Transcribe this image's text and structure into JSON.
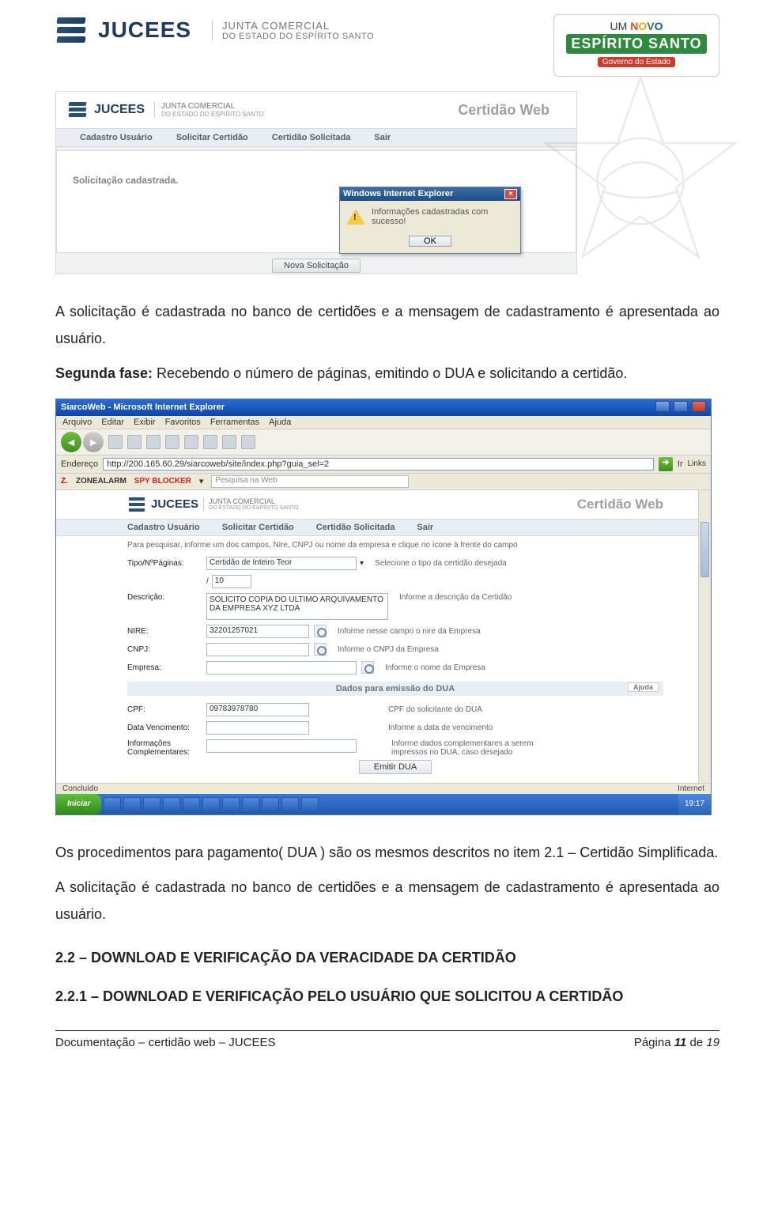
{
  "header": {
    "brand": "JUCEES",
    "sub1": "JUNTA COMERCIAL",
    "sub2": "DO ESTADO DO ESPÍRITO SANTO",
    "novo_prefix": "UM",
    "novo": "NOVO",
    "espirito": "ESPÍRITO SANTO",
    "governo": "Governo do Estado"
  },
  "shot1": {
    "appTitle": "Certidão Web",
    "menu": [
      "Cadastro Usuário",
      "Solicitar Certidão",
      "Certidão Solicitada",
      "Sair"
    ],
    "message": "Solicitação cadastrada.",
    "novaBtn": "Nova Solicitação",
    "dialog": {
      "title": "Windows Internet Explorer",
      "text": "Informações cadastradas com sucesso!",
      "ok": "OK"
    }
  },
  "body": {
    "p1": "A solicitação é cadastrada no banco de certidões e a mensagem de cadastramento é apresentada ao usuário.",
    "p2_lead": "Segunda fase:",
    "p2_rest": " Recebendo o número de páginas, emitindo o DUA e solicitando a certidão.",
    "p3": "Os procedimentos para pagamento( DUA ) são os mesmos descritos no item 2.1 – Certidão Simplificada.",
    "p4": "A solicitação é cadastrada no banco de certidões e a mensagem de cadastramento é apresentada ao usuário.",
    "h1": "2.2 – DOWNLOAD E VERIFICAÇÃO DA VERACIDADE DA CERTIDÃO",
    "h2": "2.2.1 – DOWNLOAD E VERIFICAÇÃO PELO USUÁRIO QUE SOLICITOU A CERTIDÃO"
  },
  "shot2": {
    "windowTitle": "SiarcoWeb - Microsoft Internet Explorer",
    "menus": [
      "Arquivo",
      "Editar",
      "Exibir",
      "Favoritos",
      "Ferramentas",
      "Ajuda"
    ],
    "addrLabel": "Endereço",
    "url": "http://200.165.60.29/siarcoweb/site/index.php?guia_sel=2",
    "go": "Ir",
    "links": "Links",
    "zone_z": "ZONEALARM",
    "zone_spy": "SPY BLOCKER",
    "zone_search": "Pesquisa na Web",
    "cw_title": "Certidão Web",
    "cw_menu": [
      "Cadastro Usuário",
      "Solicitar Certidão",
      "Certidão Solicitada",
      "Sair"
    ],
    "cw_note": "Para pesquisar, informe um dos campos, Nire, CNPJ ou nome da empresa e clique no ícone à frente do campo",
    "form": {
      "tipo_label": "Tipo/NºPáginas:",
      "tipo_value": "Certidão de Inteiro Teor",
      "pagina_value": "10",
      "tipo_hint": "Selecione o tipo da certidão desejada",
      "desc_label": "Descrição:",
      "desc_value": "SOLICITO COPIA DO ULTIMO ARQUIVAMENTO DA EMPRESA XYZ LTDA",
      "desc_hint": "Informe a descrição da Certidão",
      "nire_label": "NIRE:",
      "nire_value": "32201257021",
      "nire_hint": "Informe nesse campo o nire da Empresa",
      "cnpj_label": "CNPJ:",
      "cnpj_value": "",
      "cnpj_hint": "Informe o CNPJ da Empresa",
      "emp_label": "Empresa:",
      "emp_value": "",
      "emp_hint": "Informe o nome da Empresa",
      "dua_section": "Dados para emissão do DUA",
      "dua_help": "Ajuda",
      "cpf_label": "CPF:",
      "cpf_value": "09783978780",
      "cpf_hint": "CPF do solicitante do DUA",
      "data_label": "Data Vencimento:",
      "data_value": "",
      "data_hint": "Informe a data de vencimento",
      "info_label": "Informações Complementares:",
      "info_value": "",
      "info_hint": "Informe dados complementares a serem impressos no DUA, caso desejado",
      "emit": "Emitir DUA"
    },
    "status_left": "Concluído",
    "status_right": "Internet",
    "start": "Iniciar",
    "clock": "19:17"
  },
  "footer": {
    "left": "Documentação – certidão web – JUCEES",
    "right_label": "Página ",
    "right_num": "11",
    "right_de": " de ",
    "right_total": "19"
  }
}
